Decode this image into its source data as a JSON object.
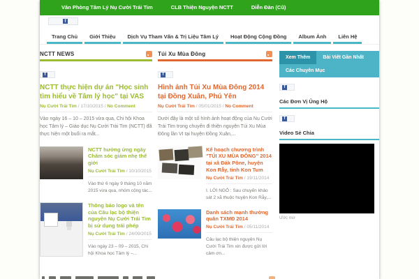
{
  "misc": {
    "sep": " / "
  },
  "icons": {
    "facebook": "f"
  },
  "topbar": {
    "items": [
      {
        "label": "Văn Phòng Tâm Lý Nụ Cười Trái Tim"
      },
      {
        "label": "CLB Thiện Nguyện NCTT"
      },
      {
        "label": "Diễn Đàn (Cũ)"
      }
    ]
  },
  "nav": {
    "items": [
      {
        "label": "Trang Chủ"
      },
      {
        "label": "Giới Thiệu"
      },
      {
        "label": "Dịch Vụ Tham Vấn & Trị Liệu Tâm Lý"
      },
      {
        "label": "Hoạt Động Cộng Đồng"
      },
      {
        "label": "Album Ảnh"
      },
      {
        "label": "Liên Hệ"
      }
    ]
  },
  "columns": [
    {
      "title": "NCTT NEWS",
      "accent_color": "#9cba32",
      "featured": {
        "title": "NCTT thực hiện dự án \"Học sinh tìm hiểu về Tâm lý học\" tại VAS",
        "author": "Nụ Cười Trái Tim",
        "date": "17/10/2015",
        "comments": "No Comment",
        "excerpt": "Vào ngày 16 – 10 – 2015 vừa qua, Chi hội Khoa học Tâm lý – Giáo dục Nụ Cười Trái Tim (NCTT) đã thực hiện một buổi ra mắt..."
      },
      "posts": [
        {
          "title": "NCTT hưởng ứng ngày Chăm sóc giảm nhẹ thế giới",
          "author": "Nụ Cười Trái Tim",
          "date": "10/10/2015",
          "excerpt": "Vào thứ 6 ngày 9 tháng 10 năm 2015 vừa qua, nhóm cộng tác...",
          "thumb": "group-photo-in-hall"
        },
        {
          "title": "Thông báo logo và tên của Câu lạc bộ thiện nguyện Nụ Cười Trái Tim bị sử dụng trái phép",
          "author": "Nụ Cười Trái Tim",
          "date": "24/09/2015",
          "excerpt": "Vào ngày 23 – 09 – 2015, Chi hội Khoa học Tâm lý –...",
          "thumb": "facebook-page-screenshot"
        }
      ]
    },
    {
      "title": "Túi Xu Mùa Đông",
      "accent_color": "#e0672e",
      "featured": {
        "title": "Hình ảnh Túi Xu Mùa Đông 2014 tại Đồng Xuân, Phú Yên",
        "author": "Nụ Cười Trái Tim",
        "date": "05/01/2015",
        "comments": "No Comment",
        "excerpt": "Dưới đây là một số hình ảnh hoạt động của Nụ Cười Trái Tim trong chuyến đi thiện nguyện Túi Xu Mùa Đông lần VI tại huyện Đồng Xuân,..."
      },
      "posts": [
        {
          "title": "Kế hoạch chương trình \"TÚI XU MÙA ĐÔNG\" 2014 tại xã Đák Pône, huyện Kon Rẫy, tỉnh Kon Tum",
          "author": "Nụ Cười Trái Tim",
          "date": "19/11/2014",
          "excerpt": "I. LỜI NGỎ : Sau chuyến khảo sát 2 xã thuộc huyện Kon Rẫy,...",
          "thumb": "photo-collage"
        },
        {
          "title": "Danh sách mạnh thường quân TXMĐ 2014",
          "author": "Nụ Cười Trái Tim",
          "date": "05/11/2014",
          "excerpt": "Câu lạc bộ thiện nguyện Nụ Cười Trái Tim xin được gửi lời cảm ơn...",
          "thumb": "red-flowers-blue-sky"
        }
      ]
    }
  ],
  "sidebar": {
    "tabs": [
      {
        "label": "Xem Thêm",
        "active": true
      },
      {
        "label": "Bài Viết Gần Nhất",
        "active": false
      },
      {
        "label": "Các Chuyên Mục",
        "active": false
      }
    ],
    "supporters_heading": "Các Đơn Vị Ủng Hộ",
    "video_heading": "Video Sẻ Chia",
    "video_caption": "Ước mơ"
  }
}
